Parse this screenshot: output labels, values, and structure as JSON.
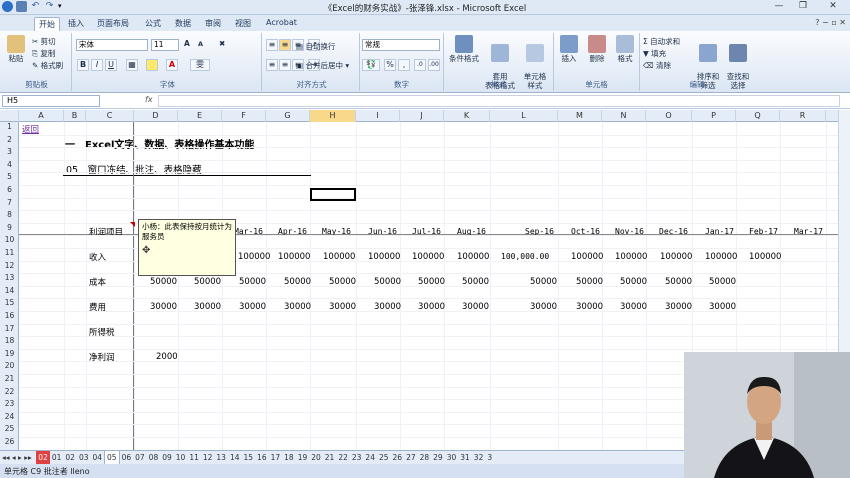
{
  "window": {
    "title": "《Excel的财务实战》-张泽锋.xlsx - Microsoft Excel",
    "minimize": "—",
    "restore": "❐",
    "close": "✕"
  },
  "tabs": [
    "开始",
    "插入",
    "页面布局",
    "公式",
    "数据",
    "审阅",
    "视图",
    "Acrobat"
  ],
  "ribbon": {
    "clipboard": {
      "paste": "粘贴",
      "cut": "剪切",
      "copy": "复制",
      "format_painter": "格式刷",
      "label": "剪贴板"
    },
    "font": {
      "name": "宋体",
      "size": "11",
      "bold": "B",
      "italic": "I",
      "underline": "U",
      "grow": "A",
      "shrink": "A",
      "label": "字体"
    },
    "alignment": {
      "wrap": "自动换行",
      "merge": "合并后居中",
      "label": "对齐方式"
    },
    "number": {
      "format": "常规",
      "percent": "%",
      "comma": ",",
      "label": "数字"
    },
    "styles": {
      "conditional": "条件格式",
      "table": "套用\n表格格式",
      "cell": "单元格\n样式",
      "label": "样式"
    },
    "cells": {
      "insert": "插入",
      "delete": "删除",
      "format": "格式",
      "label": "单元格"
    },
    "editing": {
      "autosum": "Σ 自动求和",
      "fill": "填充",
      "clear": "清除",
      "sort": "排序和\n筛选",
      "find": "查找和\n选择",
      "label": "编辑"
    }
  },
  "formula_bar": {
    "name_box": "H5",
    "fx": "fx",
    "value": ""
  },
  "columns": [
    "A",
    "B",
    "C",
    "D",
    "E",
    "F",
    "G",
    "H",
    "I",
    "J",
    "K",
    "L",
    "M",
    "N",
    "O",
    "P",
    "Q",
    "R"
  ],
  "selected_column": "H",
  "rows": [
    "1",
    "2",
    "3",
    "4",
    "5",
    "6",
    "7",
    "8",
    "9",
    "10",
    "11",
    "12",
    "13",
    "14",
    "15",
    "16",
    "17",
    "18",
    "19",
    "20",
    "21",
    "22",
    "23",
    "24",
    "25",
    "26"
  ],
  "sheet": {
    "back_link": "返回",
    "section_title": "一　Excel文字、数据、表格操作基本功能",
    "subsection": "05　窗口冻结、批注、表格隐藏",
    "header_label": "利润项目",
    "months": [
      "Mar-16",
      "Apr-16",
      "May-16",
      "Jun-16",
      "Jul-16",
      "Aug-16",
      "Sep-16",
      "Oct-16",
      "Nov-16",
      "Dec-16",
      "Jan-17",
      "Feb-17",
      "Mar-17"
    ],
    "row_income": {
      "label": "收入",
      "values": [
        "100000",
        "100000",
        "100000",
        "100000",
        "100000",
        "100000",
        "100,000.00",
        "100000",
        "100000",
        "100000",
        "100000",
        "100000"
      ]
    },
    "row_cost": {
      "label": "成本",
      "values": [
        "50000",
        "50000",
        "50000",
        "50000",
        "50000",
        "50000",
        "50000",
        "50000",
        "50000",
        "50000",
        "50000",
        "50000",
        "50000"
      ]
    },
    "row_expense": {
      "label": "费用",
      "values": [
        "30000",
        "30000",
        "30000",
        "30000",
        "30000",
        "30000",
        "30000",
        "30000",
        "30000",
        "30000",
        "30000",
        "30000",
        "30000"
      ]
    },
    "row_tax": {
      "label": "所得税"
    },
    "row_net": {
      "label": "净利润",
      "value": "2000"
    }
  },
  "comment": {
    "text": "小杨：此表保持按月统计为服务员"
  },
  "sheet_tabs": [
    "02",
    "01",
    "02",
    "03",
    "04",
    "05",
    "06",
    "07",
    "08",
    "09",
    "10",
    "11",
    "12",
    "13",
    "14",
    "15",
    "16",
    "17",
    "18",
    "19",
    "20",
    "21",
    "22",
    "23",
    "24",
    "25",
    "26",
    "27",
    "28",
    "29",
    "30",
    "31",
    "32",
    "3"
  ],
  "status": "单元格 C9 批注者 lleno",
  "colors": {
    "ribbon_bg": "#dbe6f4",
    "selected_col": "#f8d88a",
    "comment_bg": "#ffffe1",
    "link": "#7030a0"
  }
}
